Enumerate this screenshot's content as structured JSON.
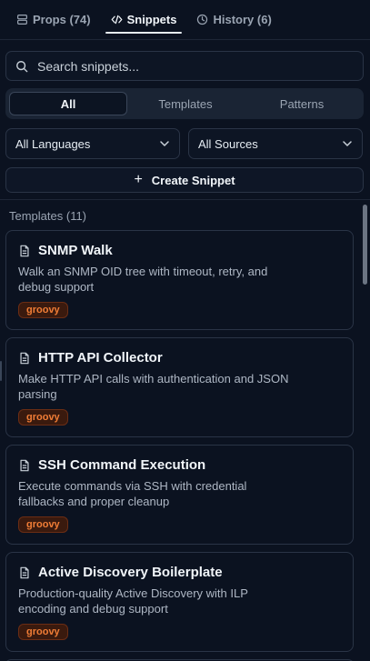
{
  "tabs": [
    {
      "label": "Props (74)",
      "icon": "stack-icon",
      "active": false
    },
    {
      "label": "Snippets",
      "icon": "code-icon",
      "active": true
    },
    {
      "label": "History (6)",
      "icon": "clock-icon",
      "active": false
    }
  ],
  "search": {
    "placeholder": "Search snippets...",
    "value": ""
  },
  "segments": [
    {
      "label": "All",
      "active": true
    },
    {
      "label": "Templates",
      "active": false
    },
    {
      "label": "Patterns",
      "active": false
    }
  ],
  "filters": {
    "language": "All Languages",
    "source": "All Sources"
  },
  "create_button": "Create Snippet",
  "section_title": "Templates (11)",
  "snippets": [
    {
      "title": "SNMP Walk",
      "description": "Walk an SNMP OID tree with timeout, retry, and debug support",
      "tag": "groovy"
    },
    {
      "title": "HTTP API Collector",
      "description": "Make HTTP API calls with authentication and JSON parsing",
      "tag": "groovy"
    },
    {
      "title": "SSH Command Execution",
      "description": "Execute commands via SSH with credential fallbacks and proper cleanup",
      "tag": "groovy"
    },
    {
      "title": "Active Discovery Boilerplate",
      "description": "Production-quality Active Discovery with ILP encoding and debug support",
      "tag": "groovy"
    }
  ],
  "colors": {
    "background": "#0b1220",
    "accent_tag": "#f07d36",
    "border": "#2a3446"
  }
}
